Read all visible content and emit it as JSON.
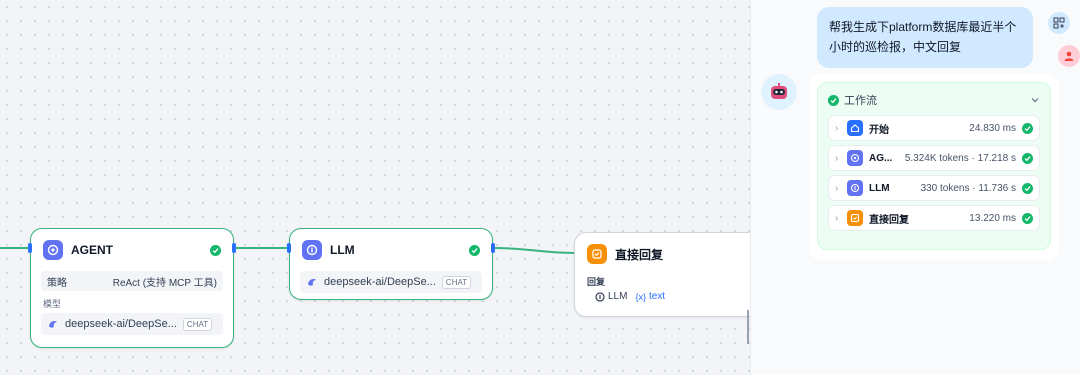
{
  "canvas": {
    "nodes": {
      "agent": {
        "title": "AGENT",
        "strategy_label": "策略",
        "strategy_value": "ReAct (支持 MCP 工具)",
        "model_label": "模型",
        "model_name": "deepseek-ai/DeepSe...",
        "model_tag": "CHAT"
      },
      "llm": {
        "title": "LLM",
        "model_name": "deepseek-ai/DeepSe...",
        "model_tag": "CHAT"
      },
      "reply": {
        "title": "直接回复",
        "field_label": "回复",
        "var_node": "LLM",
        "var_name": "text",
        "var_prefix": "{x}"
      }
    }
  },
  "chat": {
    "user_message": "帮我生成下platform数据库最近半个小时的巡检报，中文回复",
    "workflow": {
      "title": "工作流",
      "steps": [
        {
          "name": "开始",
          "meta": "24.830 ms",
          "icon": "home-icon",
          "color": "#2970ff"
        },
        {
          "name": "AG...",
          "meta": "5.324K tokens · 17.218 s",
          "icon": "agent-icon",
          "color": "#6172f3"
        },
        {
          "name": "LLM",
          "meta": "330 tokens · 11.736 s",
          "icon": "llm-icon",
          "color": "#6172f3"
        },
        {
          "name": "直接回复",
          "meta": "13.220 ms",
          "icon": "reply-icon",
          "color": "#f79009"
        }
      ]
    }
  },
  "colors": {
    "accent": "#2970ff",
    "success": "#12b76a",
    "node_border": "#36b37e",
    "bubble": "#d1e9ff"
  }
}
